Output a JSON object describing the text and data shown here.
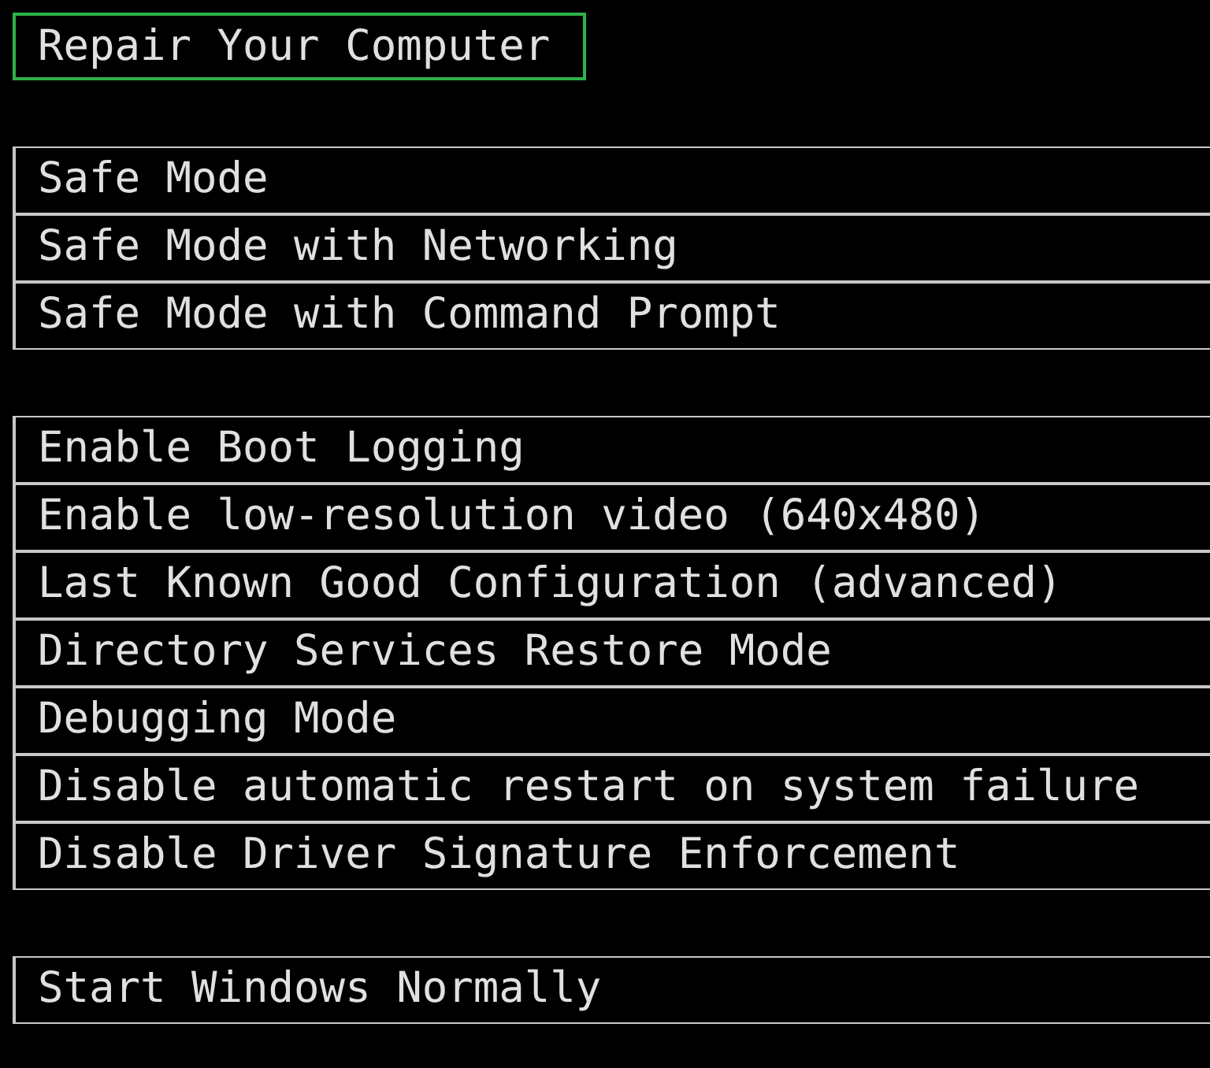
{
  "groups": [
    {
      "items": [
        {
          "label": "Repair Your Computer",
          "selected": true
        }
      ]
    },
    {
      "items": [
        {
          "label": "Safe Mode",
          "selected": false
        },
        {
          "label": "Safe Mode with Networking",
          "selected": false
        },
        {
          "label": "Safe Mode with Command Prompt",
          "selected": false
        }
      ]
    },
    {
      "items": [
        {
          "label": "Enable Boot Logging",
          "selected": false
        },
        {
          "label": "Enable low-resolution video (640x480)",
          "selected": false
        },
        {
          "label": "Last Known Good Configuration (advanced)",
          "selected": false
        },
        {
          "label": "Directory Services Restore Mode",
          "selected": false
        },
        {
          "label": "Debugging Mode",
          "selected": false
        },
        {
          "label": "Disable automatic restart on system failure",
          "selected": false
        },
        {
          "label": "Disable Driver Signature Enforcement",
          "selected": false
        }
      ]
    },
    {
      "items": [
        {
          "label": "Start Windows Normally",
          "selected": false
        }
      ]
    }
  ]
}
